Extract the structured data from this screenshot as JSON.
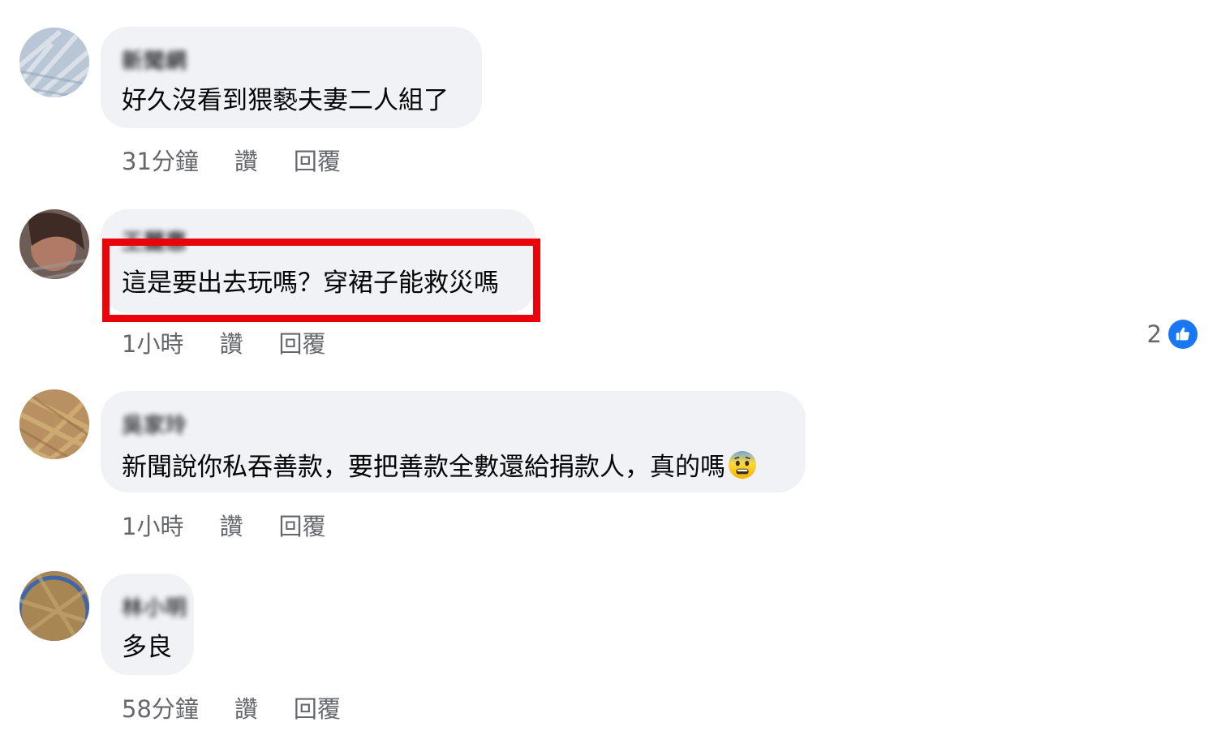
{
  "comments": [
    {
      "author": "新聞網",
      "text": "好久沒看到猥褻夫妻二人組了",
      "time": "31分鐘",
      "like_label": "讚",
      "reply_label": "回覆"
    },
    {
      "author": "王麗惠",
      "text": "這是要出去玩嗎？穿裙子能救災嗎",
      "time": "1小時",
      "like_label": "讚",
      "reply_label": "回覆",
      "reaction_count": "2",
      "reaction_icon": "thumbs-up-icon",
      "highlight_color": "#e9040c"
    },
    {
      "author": "吳家玲",
      "text": "新聞說你私吞善款，要把善款全數還給捐款人，真的嗎",
      "emoji": "anxious-face-icon",
      "time": "1小時",
      "like_label": "讚",
      "reply_label": "回覆"
    },
    {
      "author": "林小明",
      "text": "多良",
      "time": "58分鐘",
      "like_label": "讚",
      "reply_label": "回覆"
    }
  ],
  "colors": {
    "bubble": "#f0f2f5",
    "meta_text": "#65676b",
    "like_badge": "#1877f2",
    "highlight": "#e9040c"
  }
}
